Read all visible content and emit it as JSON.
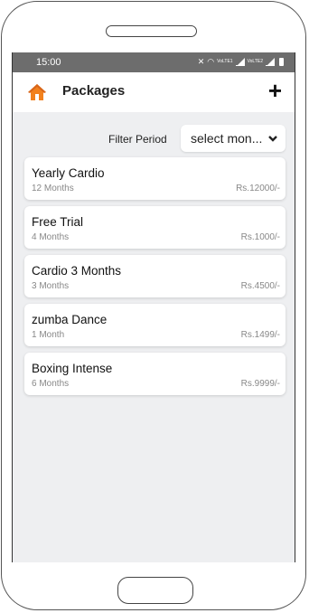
{
  "status_bar": {
    "time": "15:00",
    "icons": [
      "mute-icon",
      "wifi-icon",
      "volte1-icon",
      "signal1-icon",
      "volte2-icon",
      "signal2-icon",
      "battery-icon"
    ],
    "volte1": "VoLTE1",
    "volte2": "VoLTE2"
  },
  "header": {
    "title": "Packages",
    "add_label": "+"
  },
  "filter": {
    "label": "Filter Period",
    "value": "select mon...",
    "chevron": "⌄"
  },
  "packages": [
    {
      "name": "Yearly Cardio",
      "duration": "12 Months",
      "price": "Rs.12000/-"
    },
    {
      "name": "Free Trial",
      "duration": "4 Months",
      "price": "Rs.1000/-"
    },
    {
      "name": "Cardio 3 Months",
      "duration": "3 Months",
      "price": "Rs.4500/-"
    },
    {
      "name": "zumba Dance",
      "duration": "1 Month",
      "price": "Rs.1499/-"
    },
    {
      "name": "Boxing Intense",
      "duration": "6 Months",
      "price": "Rs.9999/-"
    }
  ],
  "colors": {
    "accent": "#f2811d",
    "status_bar": "#6d6d6d",
    "background": "#eeeff1"
  }
}
